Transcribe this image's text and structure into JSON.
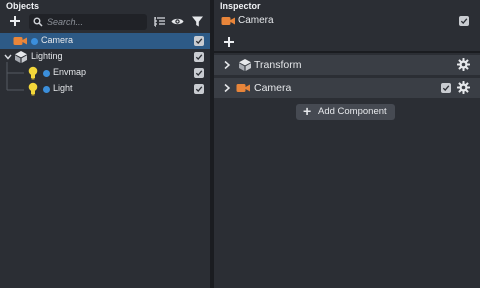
{
  "objects_panel": {
    "title": "Objects",
    "toolbar": {
      "add_icon": "plus-icon",
      "search_placeholder": "Search...",
      "icons": [
        "search-icon",
        "list-icon",
        "eye-icon",
        "filter-icon"
      ]
    },
    "tree": [
      {
        "label": "Camera",
        "icon": "camera-icon",
        "selected": true,
        "checked": true,
        "depth": 0
      },
      {
        "label": "Lighting",
        "icon": "group-icon",
        "expanded": true,
        "checked": true,
        "depth": 0
      },
      {
        "label": "Envmap",
        "icon": "lightbulb-icon",
        "checked": true,
        "depth": 1
      },
      {
        "label": "Light",
        "icon": "lightbulb-icon",
        "checked": true,
        "depth": 1
      }
    ]
  },
  "inspector": {
    "title": "Inspector",
    "object_name": "Camera",
    "object_checked": true,
    "components": [
      {
        "label": "Transform",
        "icon": "cube-icon",
        "has_checkbox": false
      },
      {
        "label": "Camera",
        "icon": "camera-icon",
        "has_checkbox": true,
        "checked": true
      }
    ],
    "add_component_label": "Add Component"
  },
  "colors": {
    "selection": "#2d5a86",
    "camera_orange": "#e8853a",
    "bulb_yellow": "#f2d63a",
    "dot_blue": "#3b8fdc"
  }
}
